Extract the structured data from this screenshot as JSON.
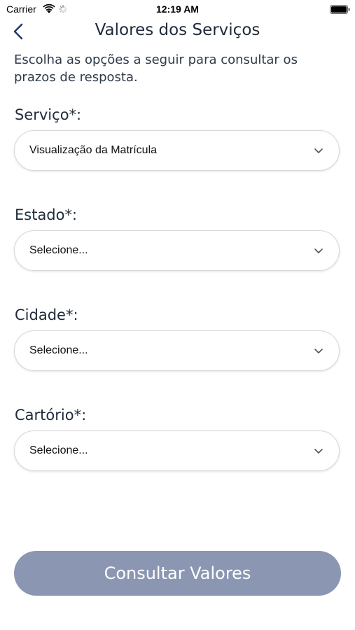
{
  "status_bar": {
    "carrier": "Carrier",
    "time": "12:19 AM"
  },
  "nav": {
    "title": "Valores dos Serviços"
  },
  "intro": "Escolha as opções a seguir para consultar os prazos de resposta.",
  "fields": [
    {
      "label": "Serviço*:",
      "value": "Visualização da Matrícula"
    },
    {
      "label": "Estado*:",
      "value": "Selecione..."
    },
    {
      "label": "Cidade*:",
      "value": "Selecione..."
    },
    {
      "label": "Cartório*:",
      "value": "Selecione..."
    }
  ],
  "submit": {
    "label": "Consultar Valores",
    "color": "#8b97b2"
  },
  "icons": [
    "wifi-icon",
    "activity-spinner-icon",
    "battery-icon",
    "back-chevron-icon",
    "chevron-down-icon"
  ]
}
